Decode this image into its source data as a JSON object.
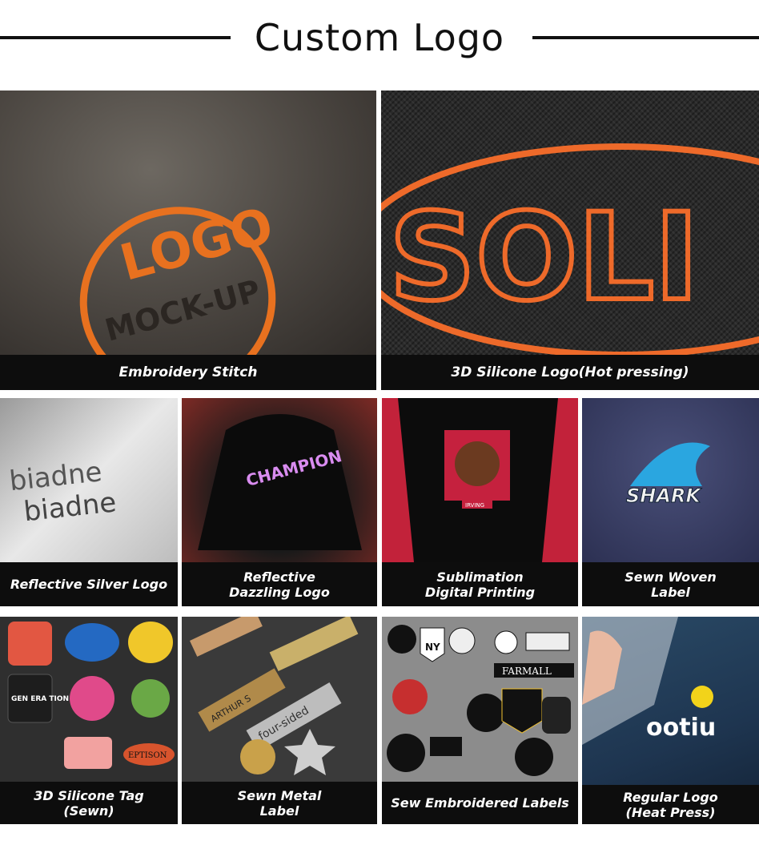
{
  "header": {
    "title": "Custom Logo"
  },
  "tiles": [
    {
      "caption": "Embroidery Stitch",
      "art": "LOGO",
      "art2": "MOCK-UP"
    },
    {
      "caption": "3D Silicone Logo(Hot pressing)",
      "art": "SOLI"
    },
    {
      "caption": "Reflective Silver Logo",
      "art": "biadne"
    },
    {
      "caption": "Reflective\nDazzling Logo",
      "art": "CHAMPION"
    },
    {
      "caption": "Sublimation\nDigital Printing",
      "art": "IRVING"
    },
    {
      "caption": "Sewn Woven\nLabel",
      "art": "SHARK"
    },
    {
      "caption": "3D Silicone Tag\n(Sewn)",
      "art": "GEN ERA TION",
      "art2": "EPTISON"
    },
    {
      "caption": "Sewn Metal\nLabel",
      "art": "ARTHUR S",
      "art2": "four-sided"
    },
    {
      "caption": "Sew Embroidered Labels",
      "art": "FARMALL",
      "art2": "NY"
    },
    {
      "caption": "Regular Logo\n(Heat Press)",
      "art": "ootiu"
    }
  ],
  "colors": {
    "orange": "#e8711f",
    "dark": "#0d0d0d",
    "navy": "#1f3550"
  }
}
